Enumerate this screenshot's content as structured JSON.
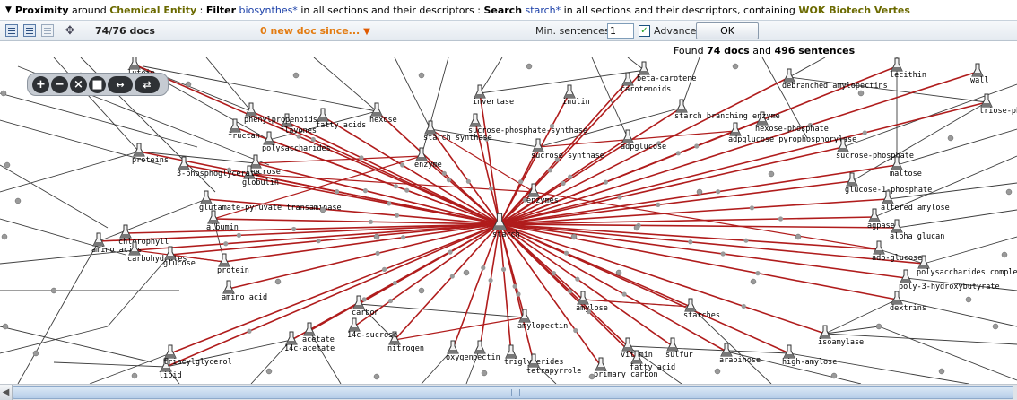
{
  "query": {
    "toggle_icon": "triangle-down-icon",
    "proximity_label": "Proximity",
    "around_text": "around",
    "entity_type": "Chemical Entity",
    "filter_label": "Filter",
    "filter_term": "biosynthes*",
    "filter_scope": "in all sections and their descriptors :",
    "search_label": "Search",
    "search_term": "starch*",
    "search_scope": "in all sections and their descriptors, containing",
    "containing_term": "WOK Biotech Vertes"
  },
  "toolbar": {
    "icons": [
      "list-view-icon",
      "table-view-icon",
      "graph-view-icon",
      "move-icon"
    ],
    "docs_count": "74/76 docs",
    "new_docs": "0 new doc since...",
    "new_docs_icon": "triangle-down-icon",
    "min_sentences_label": "Min. sentences",
    "min_sentences_value": "1",
    "advanced_label": "Advanced",
    "advanced_checked": true,
    "ok_label": "OK"
  },
  "results": {
    "found_prefix": "Found",
    "docs": "74 docs",
    "and_text": "and",
    "sentences": "496 sentences"
  },
  "zoom_controls": [
    "zoom-in-icon",
    "zoom-out-icon",
    "zoom-reset-icon",
    "stop-icon",
    "expand-icon",
    "collapse-icon"
  ],
  "graph": {
    "center": "starch",
    "link_color": "#b01c1c",
    "node_color": "#9a9a9a",
    "nodes": [
      "beta-carotene",
      "carotenoids",
      "lutein",
      "invertase",
      "inulin",
      "oxygen",
      "lecithin",
      "debranched amylopectins",
      "wall",
      "triose-phosphate",
      "sucrose-phosphate-synthase",
      "hexose",
      "fatty acids",
      "flavones",
      "phenylpropenoids",
      "fructan",
      "polysaccharides",
      "sucrose",
      "globulin",
      "proteins",
      "3-phosphoglycerate",
      "starch synthase",
      "sucrose synthase",
      "enzyme",
      "enzymes",
      "glutamate-pyruvate transaminase",
      "albumin",
      "chlorophyll",
      "amino acids",
      "carbohydrates",
      "protein",
      "amino acid",
      "glucose",
      "adp-glucose",
      "hexose-phosphate",
      "starch branching enzyme",
      "adpglucose pyrophosphorylase",
      "adpglucose",
      "amylose",
      "amylopectin",
      "carbon",
      "nitrogen",
      "acetate",
      "14c-acetate",
      "14c-sucrose",
      "triglycerides",
      "tetrapyrrole",
      "vitamin",
      "fatty acid",
      "primary carbon",
      "starches",
      "sulfur",
      "arabinose",
      "high-amylose",
      "isoamylase",
      "sucrose-phosphate",
      "glucose-1-phosphate",
      "maltose",
      "altered amylose",
      "agpase",
      "alpha glucan",
      "polysaccharides complex",
      "poly-3-hydroxybutyrate",
      "dextrins",
      "lipid",
      "triacylglycerol",
      "pectin"
    ]
  }
}
